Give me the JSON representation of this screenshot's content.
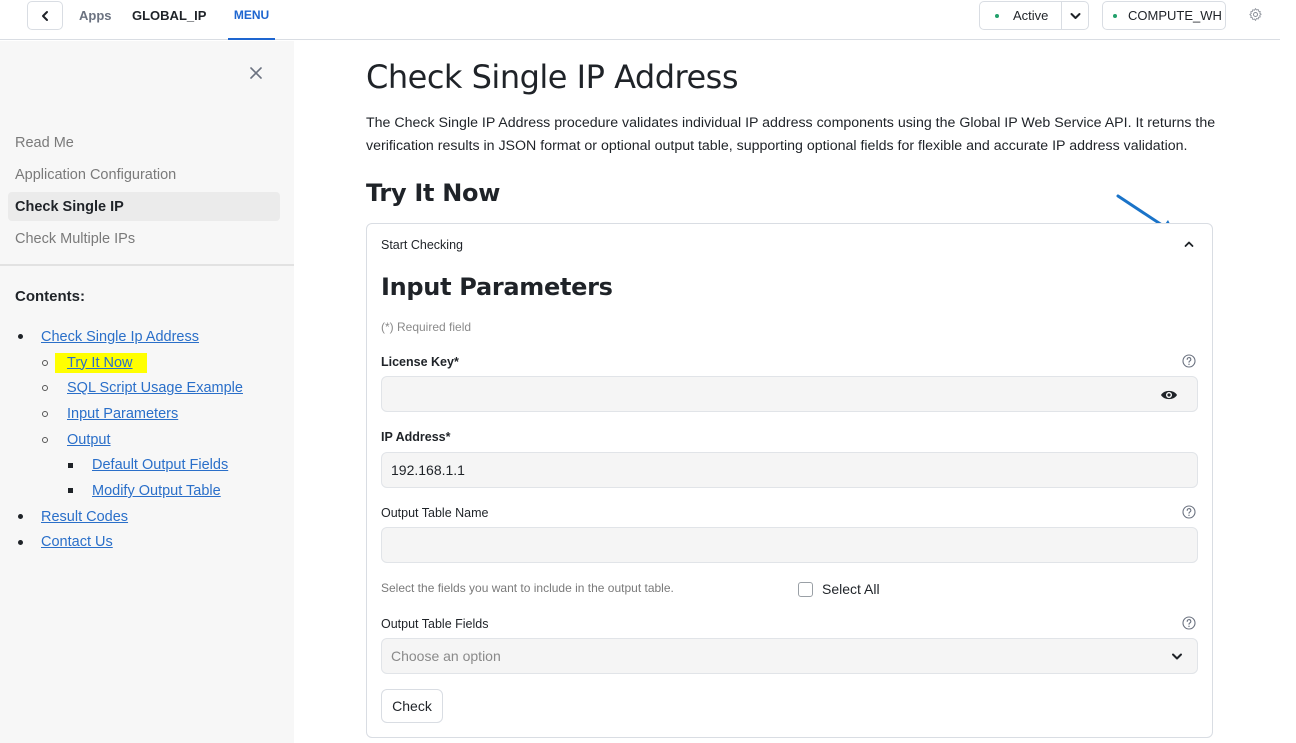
{
  "topbar": {
    "back_icon": "chevron-left-icon",
    "breadcrumb_apps": "Apps",
    "breadcrumb_app": "GLOBAL_IP",
    "tab_menu": "MENU",
    "status_label": "Active",
    "status_color": "#22a06b",
    "warehouse_label": "COMPUTE_WH",
    "settings_icon": "gear-icon",
    "accent_color": "#1e66d0"
  },
  "sidebar": {
    "close_icon": "close-icon",
    "nav_items": [
      {
        "label": "Read Me",
        "active": false
      },
      {
        "label": "Application Configuration",
        "active": false
      },
      {
        "label": "Check Single IP",
        "active": true
      },
      {
        "label": "Check Multiple IPs",
        "active": false
      }
    ],
    "contents_title": "Contents:",
    "toc": [
      {
        "label": "Check Single Ip Address",
        "level": 1
      },
      {
        "label": "Try It Now",
        "level": 2,
        "highlighted": true
      },
      {
        "label": "SQL Script Usage Example",
        "level": 2
      },
      {
        "label": "Input Parameters",
        "level": 2
      },
      {
        "label": "Output",
        "level": 2
      },
      {
        "label": "Default Output Fields",
        "level": 3
      },
      {
        "label": "Modify Output Table",
        "level": 3
      },
      {
        "label": "Result Codes",
        "level": 1
      },
      {
        "label": "Contact Us",
        "level": 1
      }
    ],
    "highlight_color": "#ffff00"
  },
  "main": {
    "title": "Check Single IP Address",
    "description": "The Check Single IP Address procedure validates individual IP address components using the Global IP Web Service API. It returns the verification results in JSON format or optional output table, supporting optional fields for flexible and accurate IP address validation.",
    "section_title": "Try It Now",
    "card": {
      "header": "Start Checking",
      "collapse_icon": "chevron-up-icon",
      "title": "Input Parameters",
      "required_note": "(*) Required field",
      "license_key": {
        "label": "License Key*",
        "value": "",
        "toggle_icon": "eye-icon",
        "help_icon": "help-circle-icon"
      },
      "ip_address": {
        "label": "IP Address*",
        "value": "192.168.1.1"
      },
      "output_table_name": {
        "label": "Output Table Name",
        "value": "",
        "help_icon": "help-circle-icon"
      },
      "fields_hint": "Select the fields you want to include in the output table.",
      "select_all": {
        "label": "Select All",
        "checked": false
      },
      "output_table_fields": {
        "label": "Output Table Fields",
        "placeholder": "Choose an option",
        "help_icon": "help-circle-icon"
      },
      "submit_label": "Check"
    },
    "annotation_arrow_color": "#1a73c8"
  }
}
